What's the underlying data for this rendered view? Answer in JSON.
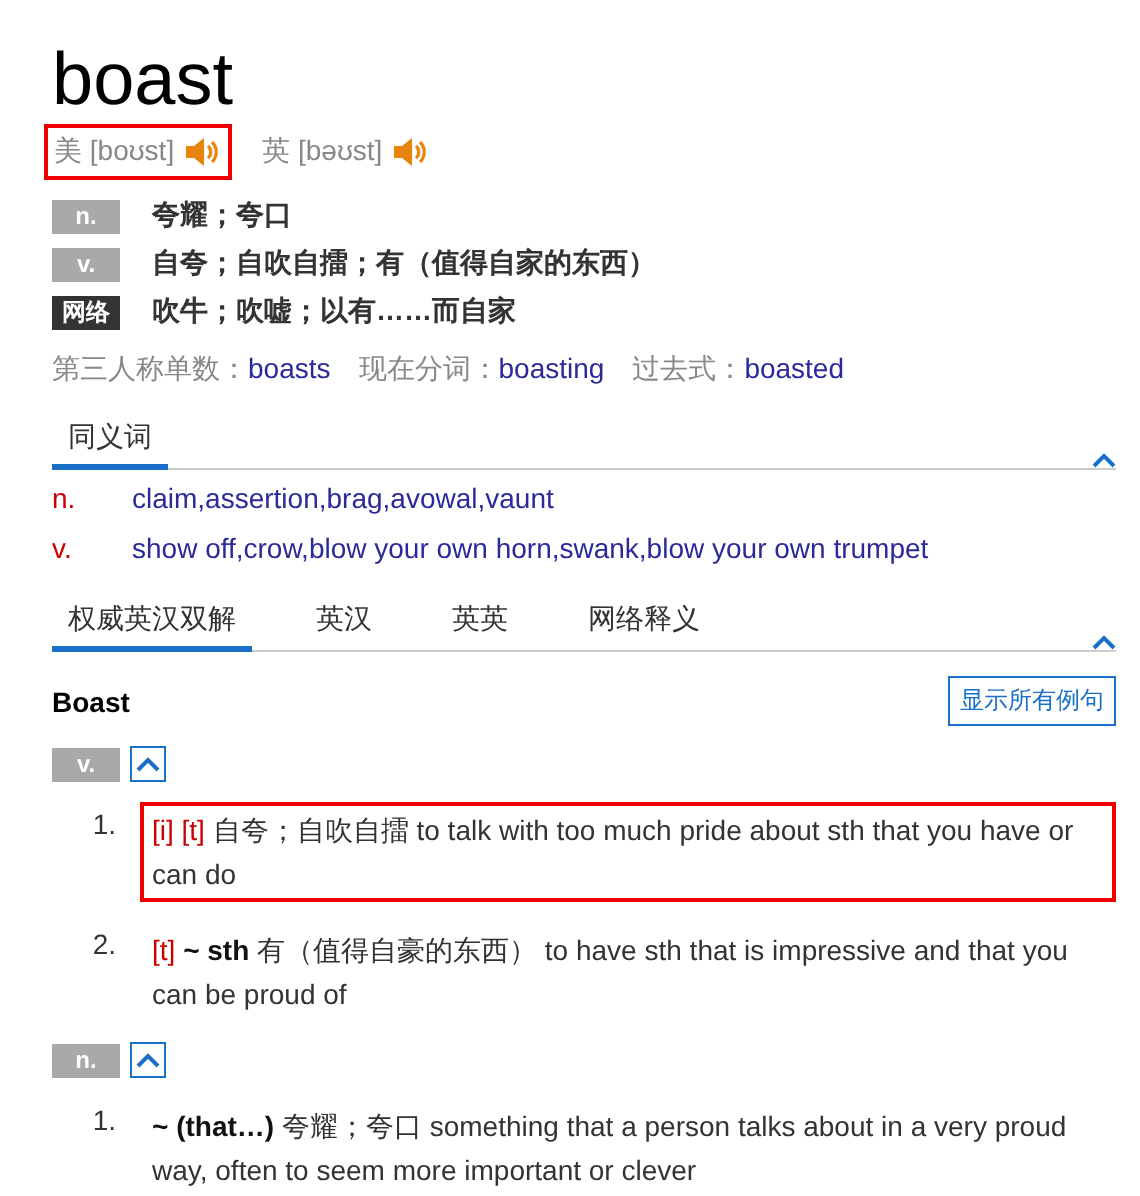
{
  "word": "boast",
  "pronunciations": [
    {
      "label": "美",
      "ipa": "[boʊst]",
      "highlighted": true
    },
    {
      "label": "英",
      "ipa": "[bəʊst]",
      "highlighted": false
    }
  ],
  "meanings": [
    {
      "kind": "pos",
      "tag": "n.",
      "text": "夸耀；夸口"
    },
    {
      "kind": "pos",
      "tag": "v.",
      "text": "自夸；自吹自擂；有（值得自家的东西）"
    },
    {
      "kind": "web",
      "tag": "网络",
      "text": "吹牛；吹嘘；以有……而自家"
    }
  ],
  "inflections": [
    {
      "label": "第三人称单数：",
      "form": "boasts"
    },
    {
      "label": "现在分词：",
      "form": "boasting"
    },
    {
      "label": "过去式：",
      "form": "boasted"
    }
  ],
  "synonym_tabs": [
    {
      "label": "同义词",
      "selected": true
    }
  ],
  "synonyms": [
    {
      "pos": "n.",
      "words": "claim,assertion,brag,avowal,vaunt"
    },
    {
      "pos": "v.",
      "words": "show off,crow,blow your own horn,swank,blow your own trumpet"
    }
  ],
  "dict_tabs": [
    {
      "label": "权威英汉双解",
      "selected": true
    },
    {
      "label": "英汉",
      "selected": false
    },
    {
      "label": "英英",
      "selected": false
    },
    {
      "label": "网络释义",
      "selected": false
    }
  ],
  "entry": {
    "headword": "Boast",
    "show_examples_button": "显示所有例句",
    "groups": [
      {
        "pos": "v.",
        "senses": [
          {
            "number": "1.",
            "tags": [
              "[i]",
              "[t]"
            ],
            "text": "自夸；自吹自擂 to talk with too much pride about sth that you have or can do",
            "highlighted": true
          },
          {
            "number": "2.",
            "tags": [
              "[t]"
            ],
            "pattern": "~ sth",
            "text": "有（值得自豪的东西） to have sth that is impressive and that you can be proud of",
            "highlighted": false
          }
        ]
      },
      {
        "pos": "n.",
        "senses": [
          {
            "number": "1.",
            "pattern": "~ (that…)",
            "text": "夸耀；夸口 something that a person talks about in a very proud way, often to seem more important or clever",
            "highlighted": false
          }
        ]
      }
    ]
  }
}
